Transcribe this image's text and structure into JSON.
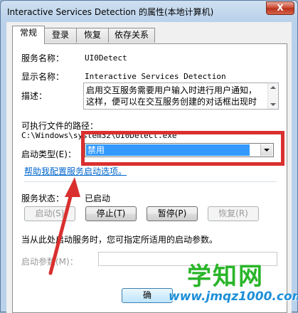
{
  "window": {
    "title": "Interactive Services Detection 的属性(本地计算机)",
    "close_glyph": "X"
  },
  "tabs": [
    {
      "label": "常规",
      "active": true
    },
    {
      "label": "登录",
      "active": false
    },
    {
      "label": "恢复",
      "active": false
    },
    {
      "label": "依存关系",
      "active": false
    }
  ],
  "general": {
    "service_name_label": "服务名称：",
    "service_name_value": "UI0Detect",
    "display_name_label": "显示名称：",
    "display_name_value": "Interactive Services Detection",
    "description_label": "描述：",
    "description_value": "启用交互服务需要用户输入时进行用户通知，这样，便可以在交互服务创建的对话框出现时",
    "exe_path_label": "可执行文件的路径：",
    "exe_path_value": "C:\\Windows\\system32\\UI0Detect.exe",
    "startup_type_label": "启动类型(E)：",
    "startup_type_value": "禁用",
    "help_link": "帮助我配置服务启动选项。",
    "status_label": "服务状态：",
    "status_value": "已启动",
    "start_button": "启动(S)",
    "stop_button": "停止(T)",
    "pause_button": "暂停(P)",
    "resume_button": "恢复(R)",
    "hint_text": "当从此处启动服务时，您可指定所适用的启动参数。",
    "start_params_label": "启动参数(M)：",
    "start_params_value": "",
    "ok_button": "确"
  },
  "icons": {
    "arrow_up": "scroll-up-icon",
    "arrow_down": "scroll-down-icon",
    "chevron": "chevron-down-icon"
  },
  "colors": {
    "highlight_frame": "#d9302f",
    "selection": "#3399ff",
    "link": "#0066cc",
    "arrow": "#d9302f"
  },
  "watermark": {
    "main": "学知网",
    "sub": "www.jmqz1000.com"
  }
}
